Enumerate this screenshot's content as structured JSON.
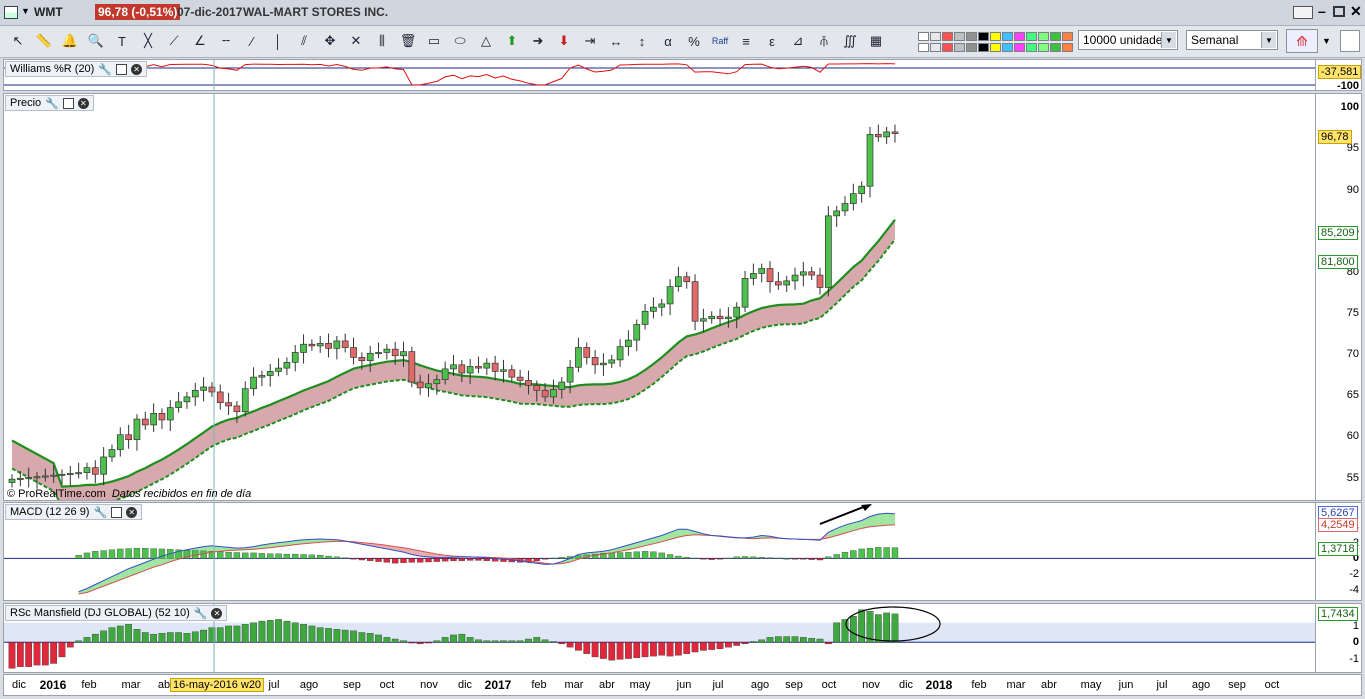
{
  "titlebar": {
    "symbol": "WMT",
    "price_change": "96,78 (-0,51%)",
    "date": "07-dic-2017",
    "name": "WAL-MART STORES INC."
  },
  "toolbar": {
    "units_value": "10000 unidades",
    "period_value": "Semanal",
    "raff_label": "Raff",
    "tool_icons": [
      "pointer-icon",
      "ruler-icon",
      "alarm-icon",
      "zoom-icon",
      "text-icon",
      "fan-icon",
      "trendline-icon",
      "ray-icon",
      "hline-icon",
      "line-icon",
      "vline-icon",
      "channel-icon",
      "move-icon",
      "cross-icon",
      "parallel-icon",
      "trash-icon",
      "rectangle-icon",
      "ellipse-icon",
      "triangle-icon",
      "arrow-up-icon",
      "arrow-right-icon",
      "arrow-down-icon",
      "extend-icon",
      "range-icon",
      "vrange-icon",
      "alpha-icon",
      "percent-icon",
      "raff-icon",
      "fibo-icon",
      "elliott-icon",
      "gann-icon",
      "pitchfork-icon",
      "cycles-icon",
      "grid-icon"
    ],
    "swatches": [
      "#ffffff",
      "#e8e8e8",
      "#ff5050",
      "#c0c0c0",
      "#909090",
      "#000000",
      "#ffff00",
      "#40c0ff",
      "#ff40ff",
      "#40ff80",
      "#80ff80",
      "#40c040",
      "#ff8040"
    ]
  },
  "panels": {
    "williams": {
      "title": "Williams %R (20)",
      "value": "-37,581",
      "ticks": [
        "-100"
      ],
      "line_color": "#e01010"
    },
    "price": {
      "title": "Precio",
      "credit": "© ProRealTime.com",
      "credit_note": "Datos recibidos en fin de día",
      "last_value": "96,78",
      "upper_band_value": "85,209",
      "lower_band_value": "81,800",
      "ticks": [
        "100",
        "95",
        "90",
        "85",
        "80",
        "75",
        "70",
        "65",
        "60",
        "55"
      ]
    },
    "macd": {
      "title": "MACD (12 26 9)",
      "values": [
        "5,6267",
        "4,2549",
        "1,3718"
      ],
      "ticks": [
        "4",
        "2",
        "0",
        "-2",
        "-4"
      ]
    },
    "mansfield": {
      "title": "RSc Mansfield (DJ GLOBAL) (52 10)",
      "value": "1,7434",
      "ticks": [
        "1",
        "0",
        "-1"
      ]
    }
  },
  "x_axis": {
    "labels": [
      "dic",
      "2016",
      "feb",
      "mar",
      "ab",
      "jul",
      "ago",
      "sep",
      "oct",
      "nov",
      "dic",
      "2017",
      "feb",
      "mar",
      "abr",
      "may",
      "jun",
      "jul",
      "ago",
      "sep",
      "oct",
      "nov",
      "dic",
      "2018",
      "feb",
      "mar",
      "abr",
      "may",
      "jun",
      "jul",
      "ago",
      "sep",
      "oct"
    ],
    "bold_labels": [
      "2016",
      "2017",
      "2018"
    ],
    "cursor_label": "16-may-2016 w20"
  },
  "chart_data": [
    {
      "type": "candlestick",
      "title": "Precio",
      "interval": "weekly",
      "x_start": "2015-12-11",
      "ylim": [
        53,
        101
      ],
      "closes": [
        55.6,
        56.2,
        55.4,
        57.5,
        58.4,
        60.2,
        59.6,
        62.1,
        61.4,
        62.8,
        62.0,
        63.5,
        64.2,
        64.8,
        65.6,
        66.0,
        65.4,
        64.1,
        63.7,
        63.0,
        65.8,
        67.2,
        67.4,
        67.9,
        68.3,
        69.0,
        70.2,
        71.2,
        71.0,
        71.3,
        70.7,
        71.6,
        70.8,
        69.6,
        69.2,
        70.1,
        70.2,
        70.6,
        69.8,
        70.3,
        66.6,
        65.9,
        66.4,
        66.9,
        68.2,
        68.7,
        67.7,
        68.5,
        68.3,
        68.9,
        67.9,
        68.1,
        67.2,
        66.8,
        66.2,
        65.6,
        64.8,
        65.7,
        66.6,
        68.4,
        70.8,
        69.6,
        68.7,
        68.9,
        69.3,
        70.9,
        71.7,
        73.6,
        75.2,
        75.7,
        76.1,
        78.2,
        79.4,
        78.8,
        74.0,
        74.3,
        74.6,
        74.3,
        74.5,
        75.7,
        79.2,
        79.8,
        80.4,
        78.8,
        78.4,
        78.9,
        79.6,
        80.0,
        79.6,
        78.1,
        86.8,
        87.4,
        88.3,
        89.5,
        90.4,
        96.7,
        96.4,
        97.0,
        96.8
      ],
      "upper_band": "red/green moving-average ribbon (ends 85,209)",
      "lower_band": "dashed green line (ends 81,800)"
    },
    {
      "type": "bar",
      "title": "MACD (12 26 9)",
      "macd_last": 5.6267,
      "signal_last": 4.2549,
      "hist_last": 1.3718,
      "ylim": [
        -5,
        6.5
      ],
      "histogram": [
        0.4,
        0.7,
        0.9,
        1.0,
        1.1,
        1.2,
        1.25,
        1.3,
        1.3,
        1.25,
        1.2,
        1.15,
        1.1,
        1.05,
        1.0,
        0.95,
        0.9,
        0.85,
        0.8,
        0.75,
        0.7,
        0.7,
        0.65,
        0.6,
        0.6,
        0.55,
        0.55,
        0.5,
        0.45,
        0.4,
        0.3,
        0.2,
        0.1,
        -0.1,
        -0.2,
        -0.3,
        -0.4,
        -0.5,
        -0.6,
        -0.55,
        -0.5,
        -0.5,
        -0.45,
        -0.4,
        -0.35,
        -0.3,
        -0.3,
        -0.25,
        -0.25,
        -0.3,
        -0.35,
        -0.4,
        -0.45,
        -0.5,
        -0.45,
        -0.3,
        -0.1,
        0.05,
        0.15,
        0.25,
        0.35,
        0.45,
        0.55,
        0.65,
        0.7,
        0.75,
        0.8,
        0.85,
        0.9,
        0.85,
        0.7,
        0.5,
        0.3,
        0.15,
        0.05,
        -0.05,
        -0.15,
        -0.1,
        0.05,
        0.2,
        0.25,
        0.2,
        0.15,
        0.1,
        0.05,
        0.0,
        -0.05,
        -0.1,
        -0.15,
        -0.2,
        0.2,
        0.5,
        0.8,
        1.0,
        1.2,
        1.3,
        1.4,
        1.38,
        1.37
      ],
      "macd_line": [
        -4.2,
        -3.8,
        -3.3,
        -2.8,
        -2.3,
        -1.8,
        -1.3,
        -0.9,
        -0.5,
        -0.1,
        0.3,
        0.6,
        0.9,
        1.1,
        1.3,
        1.5,
        1.6,
        1.5,
        1.4,
        1.3,
        1.35,
        1.5,
        1.7,
        1.85,
        2.0,
        2.1,
        2.25,
        2.35,
        2.4,
        2.45,
        2.4,
        2.35,
        2.2,
        2.0,
        1.8,
        1.6,
        1.4,
        1.2,
        1.0,
        0.8,
        0.5,
        0.3,
        0.2,
        0.1,
        0.1,
        0.15,
        0.2,
        0.2,
        0.15,
        0.1,
        0.0,
        -0.1,
        -0.2,
        -0.3,
        -0.5,
        -0.6,
        -0.75,
        -0.7,
        -0.4,
        0.0,
        0.5,
        0.7,
        0.8,
        0.9,
        1.1,
        1.4,
        1.7,
        2.0,
        2.3,
        2.6,
        2.9,
        3.3,
        3.7,
        3.7,
        3.4,
        3.1,
        2.9,
        2.8,
        2.7,
        2.6,
        2.6,
        2.7,
        2.9,
        2.8,
        2.6,
        2.5,
        2.45,
        2.4,
        2.35,
        2.3,
        3.3,
        3.8,
        4.2,
        4.5,
        4.8,
        5.3,
        5.6,
        5.7,
        5.63
      ],
      "signal_line": [
        -4.5,
        -4.3,
        -3.9,
        -3.5,
        -3.1,
        -2.7,
        -2.3,
        -1.9,
        -1.5,
        -1.1,
        -0.8,
        -0.4,
        -0.1,
        0.2,
        0.4,
        0.6,
        0.8,
        0.9,
        1.0,
        1.05,
        1.1,
        1.15,
        1.25,
        1.35,
        1.5,
        1.6,
        1.75,
        1.85,
        1.95,
        2.05,
        2.1,
        2.15,
        2.15,
        2.1,
        2.0,
        1.9,
        1.8,
        1.65,
        1.5,
        1.35,
        1.15,
        0.95,
        0.75,
        0.55,
        0.4,
        0.3,
        0.25,
        0.2,
        0.18,
        0.15,
        0.1,
        0.05,
        -0.05,
        -0.15,
        -0.3,
        -0.45,
        -0.6,
        -0.7,
        -0.65,
        -0.45,
        -0.1,
        0.2,
        0.4,
        0.55,
        0.7,
        0.9,
        1.1,
        1.35,
        1.6,
        1.85,
        2.1,
        2.4,
        2.7,
        2.9,
        3.0,
        2.95,
        2.9,
        2.85,
        2.75,
        2.65,
        2.55,
        2.5,
        2.55,
        2.6,
        2.55,
        2.5,
        2.45,
        2.4,
        2.4,
        2.4,
        2.6,
        2.9,
        3.2,
        3.5,
        3.8,
        4.0,
        4.1,
        4.2,
        4.25
      ]
    },
    {
      "type": "bar",
      "title": "RSc Mansfield (DJ GLOBAL) (52 10)",
      "last_value": 1.7434,
      "ylim": [
        -1.7,
        2.1
      ],
      "values": [
        -1.6,
        -1.5,
        -1.5,
        -1.4,
        -1.4,
        -1.3,
        -0.9,
        -0.3,
        0.1,
        0.3,
        0.5,
        0.7,
        0.9,
        1.0,
        1.1,
        0.8,
        0.6,
        0.5,
        0.55,
        0.6,
        0.6,
        0.55,
        0.65,
        0.75,
        0.9,
        0.9,
        1.0,
        1.0,
        1.1,
        1.2,
        1.3,
        1.35,
        1.4,
        1.3,
        1.2,
        1.1,
        1.0,
        0.9,
        0.85,
        0.8,
        0.75,
        0.7,
        0.6,
        0.55,
        0.45,
        0.3,
        0.2,
        0.1,
        -0.05,
        -0.1,
        -0.05,
        0.1,
        0.3,
        0.45,
        0.5,
        0.3,
        0.15,
        0.1,
        0.1,
        0.1,
        0.1,
        0.1,
        0.2,
        0.3,
        0.15,
        0.05,
        -0.1,
        -0.3,
        -0.5,
        -0.7,
        -0.9,
        -1.0,
        -1.1,
        -1.05,
        -1.0,
        -0.95,
        -0.9,
        -0.85,
        -0.8,
        -0.85,
        -0.8,
        -0.7,
        -0.6,
        -0.5,
        -0.45,
        -0.4,
        -0.3,
        -0.2,
        -0.1,
        0.05,
        0.15,
        0.3,
        0.35,
        0.35,
        0.35,
        0.3,
        0.25,
        0.2,
        -0.1
      ],
      "values_tail": [
        -0.2,
        -0.25,
        -0.2,
        0.0,
        0.3,
        0.45,
        0.5,
        0.45,
        0.35,
        0.25,
        0.15,
        0.1,
        0.05,
        -0.1,
        -0.2,
        0.8,
        1.0,
        1.2,
        1.4,
        1.6,
        2.0,
        1.9,
        1.7,
        1.8,
        1.74
      ]
    }
  ]
}
